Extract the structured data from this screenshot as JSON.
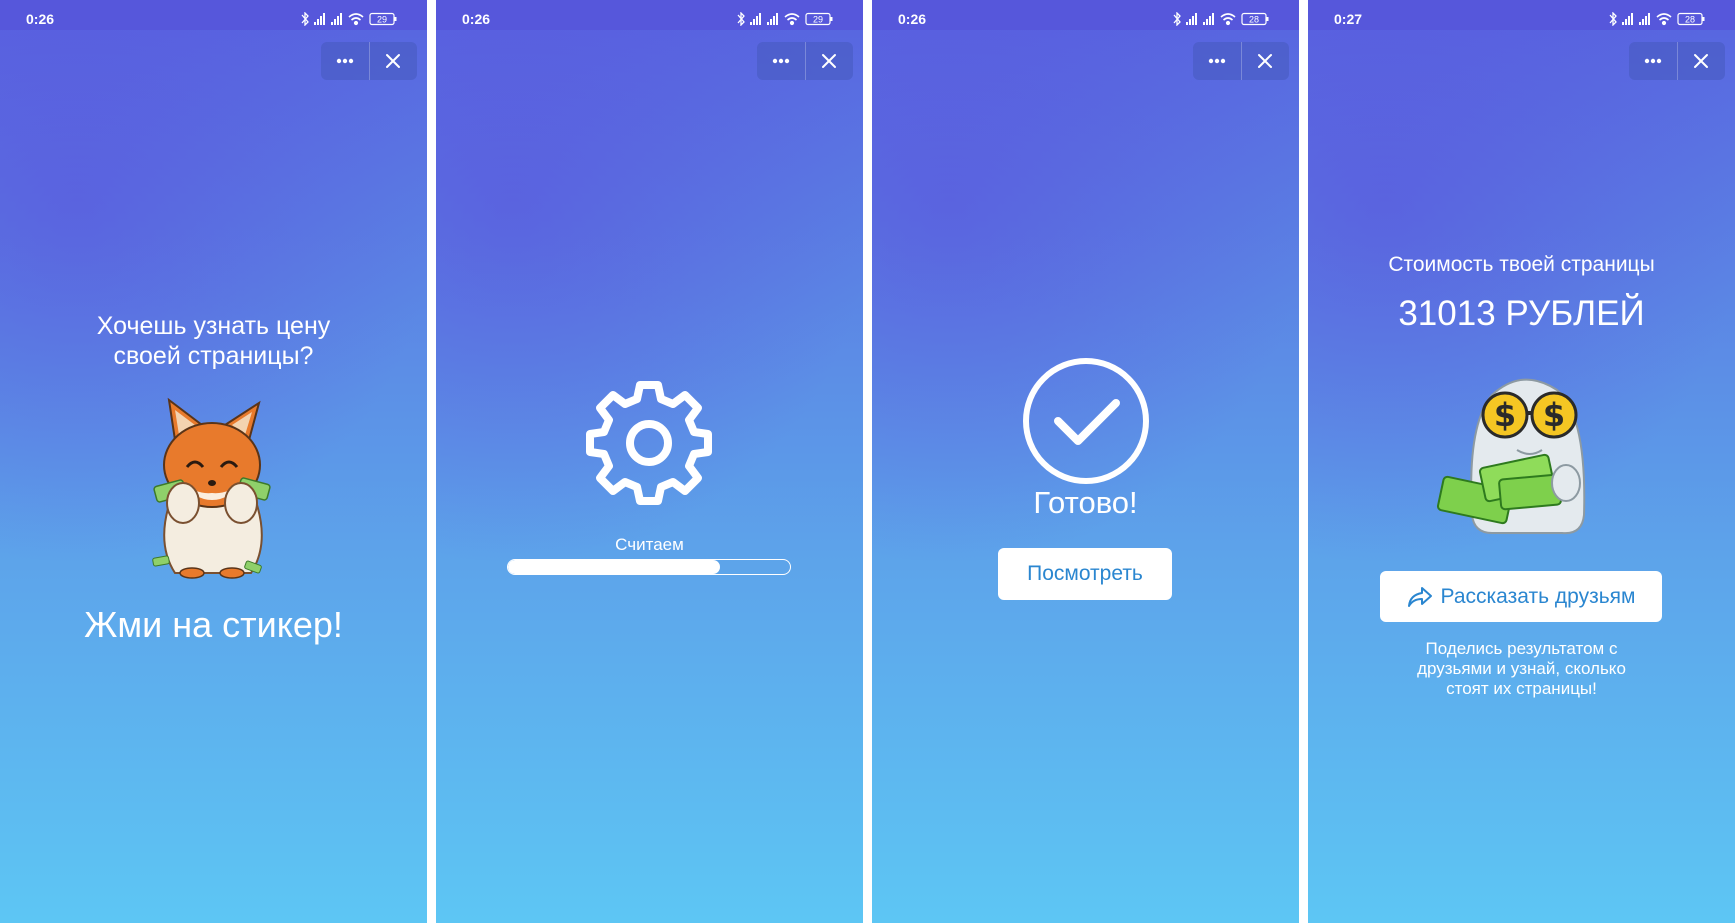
{
  "screens": [
    {
      "status": {
        "time": "0:26",
        "battery": "29"
      },
      "question": "Хочешь узнать цену своей страницы?",
      "cta": "Жми на стикер!"
    },
    {
      "status": {
        "time": "0:26",
        "battery": "29"
      },
      "loading_label": "Считаем",
      "progress": 0.75
    },
    {
      "status": {
        "time": "0:26",
        "battery": "28"
      },
      "done_label": "Готово!",
      "view_button": "Посмотреть"
    },
    {
      "status": {
        "time": "0:27",
        "battery": "28"
      },
      "result_title": "Стоимость твоей страницы",
      "result_value": "31013 РУБЛЕЙ",
      "share_button": "Рассказать друзьям",
      "share_hint": "Поделись результатом с друзьями и узнай, сколько стоят их страницы!"
    }
  ],
  "colors": {
    "statusbar": "#5657db",
    "accent": "#2a86d0",
    "gradient_top": "#5863e0",
    "gradient_bottom": "#5dc6f4"
  },
  "icons": [
    "bluetooth-icon",
    "signal-icon",
    "wifi-icon",
    "battery-icon",
    "more-icon",
    "close-icon",
    "gear-icon",
    "check-circle-icon",
    "share-icon"
  ]
}
